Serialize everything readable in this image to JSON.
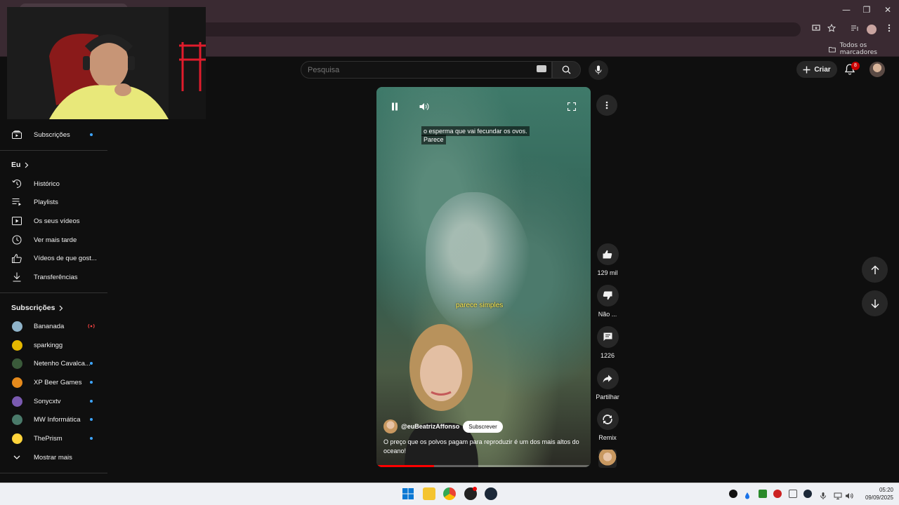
{
  "browser": {
    "bookmarks_all": "Todos os marcadores",
    "window_controls": {
      "minimize": "—",
      "maximize": "❐",
      "close": "✕"
    }
  },
  "header": {
    "search_placeholder": "Pesquisa",
    "create_label": "Criar",
    "notification_count": "8"
  },
  "sidebar": {
    "top_items": [
      {
        "label": "Subscrições",
        "icon": "subscriptions-icon",
        "dot": true
      }
    ],
    "you_heading": "Eu",
    "you_items": [
      {
        "label": "Histórico",
        "icon": "history-icon"
      },
      {
        "label": "Playlists",
        "icon": "playlist-icon"
      },
      {
        "label": "Os seus vídeos",
        "icon": "your-videos-icon"
      },
      {
        "label": "Ver mais tarde",
        "icon": "watch-later-icon"
      },
      {
        "label": "Vídeos de que gost...",
        "icon": "thumbs-up-icon"
      },
      {
        "label": "Transferências",
        "icon": "download-icon"
      }
    ],
    "subs_heading": "Subscrições",
    "channels": [
      {
        "label": "Bananada",
        "color": "#8fb3c9",
        "live": true
      },
      {
        "label": "sparkingg",
        "color": "#e5b800",
        "live": false
      },
      {
        "label": "Netenho Cavalca...",
        "color": "#3a5a3a",
        "live": false
      },
      {
        "label": "XP Beer Games",
        "color": "#e58a1c",
        "live": false
      },
      {
        "label": "Sonycxtv",
        "color": "#7a5ab0",
        "live": false
      },
      {
        "label": "MW Informática",
        "color": "#4a7a6a",
        "live": false
      },
      {
        "label": "ThePrism",
        "color": "#ffd43b",
        "live": false
      }
    ],
    "show_more": "Mostrar mais"
  },
  "player": {
    "caption_top_line1": "o esperma que vai fecundar os ovos.",
    "caption_top_line2": "Parece",
    "caption_mid": "parece simples",
    "channel_name": "@euBeatrizAffonso",
    "subscribe_label": "Subscrever",
    "title": "O preço que os polvos pagam para reproduzir é um dos mais altos do oceano!",
    "progress_fraction": 0.27
  },
  "actions": {
    "likes": "129 mil",
    "dislike": "Não ...",
    "comments": "1226",
    "share": "Partilhar",
    "remix": "Remix"
  },
  "taskbar": {
    "time": "05:20",
    "date": "09/09/2025"
  }
}
